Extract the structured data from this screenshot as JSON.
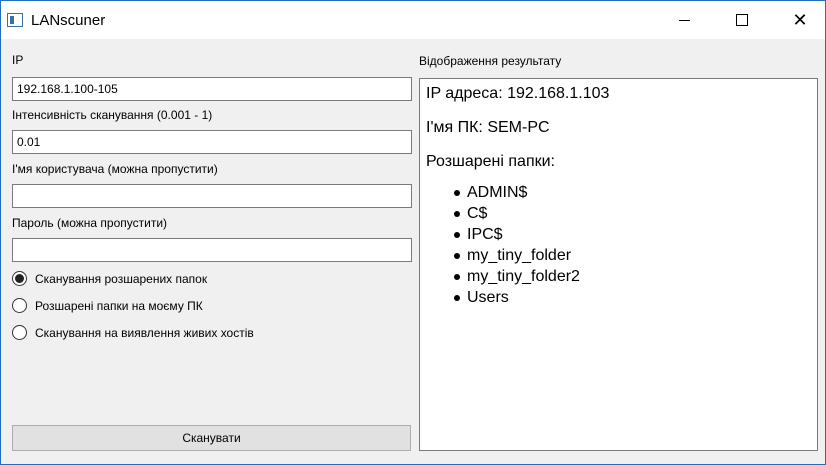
{
  "window": {
    "title": "LANscuner"
  },
  "form": {
    "ip_label": "IP",
    "ip_value": "192.168.1.100-105",
    "intensity_label": "Інтенсивність сканування (0.001 - 1)",
    "intensity_value": "0.01",
    "username_label": "І'мя користувача (можна пропустити)",
    "username_value": "",
    "password_label": "Пароль (можна пропустити)",
    "password_value": "",
    "modes": [
      {
        "label": "Сканування розшарених папок",
        "selected": true
      },
      {
        "label": "Розшарені папки на моєму ПК",
        "selected": false
      },
      {
        "label": "Сканування на виявлення живих хостів",
        "selected": false
      }
    ],
    "scan_button": "Сканувати"
  },
  "result": {
    "label": "Відображення результату",
    "ip_line": "IP адреса: 192.168.1.103",
    "pc_line": "І'мя ПК: SEM-PC",
    "shares_heading": "Розшарені папки:",
    "shares": [
      "ADMIN$",
      "C$",
      "IPC$",
      "my_tiny_folder",
      "my_tiny_folder2",
      "Users"
    ]
  },
  "icons": {
    "app": "window-app-icon",
    "minimize": "minimize-icon",
    "maximize": "maximize-icon",
    "close": "close-icon",
    "bullet": "bullet-icon"
  },
  "colors": {
    "accent": "#1e6fbf",
    "background": "#f0f0f0",
    "button": "#e1e1e1"
  }
}
